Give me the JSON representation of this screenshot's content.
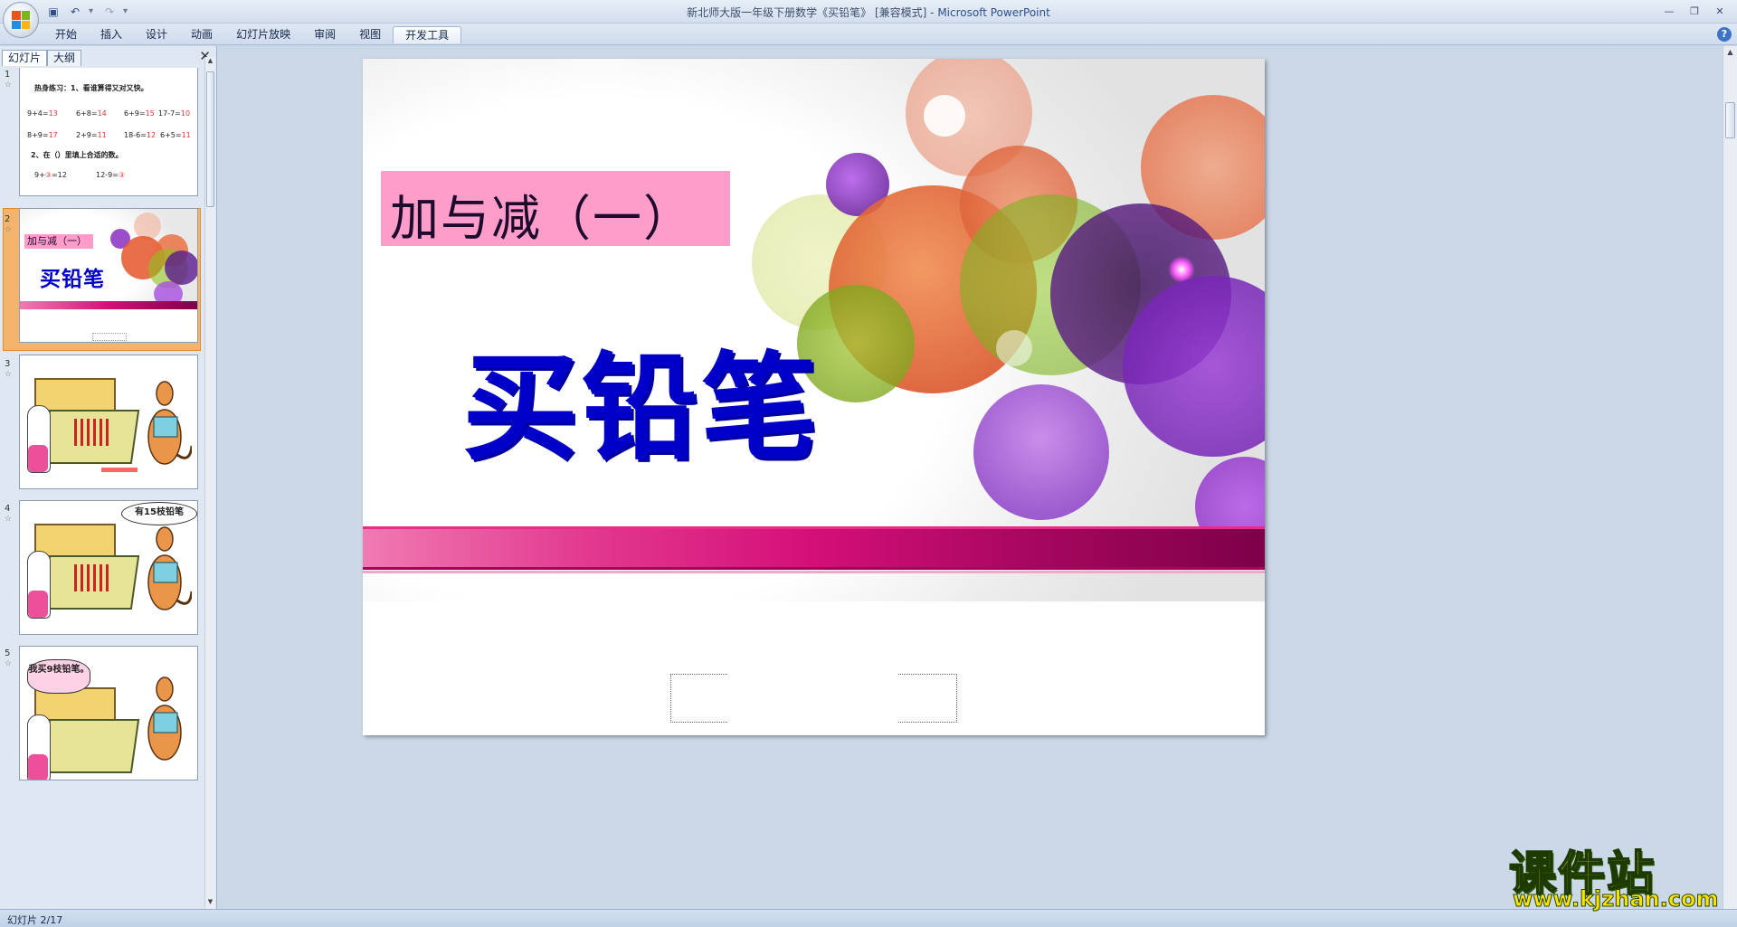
{
  "window": {
    "title": "新北师大版一年级下册数学《买铅笔》 [兼容模式] - ",
    "app_name": "Microsoft PowerPoint"
  },
  "ribbon": {
    "tabs": [
      {
        "label": "开始"
      },
      {
        "label": "插入"
      },
      {
        "label": "设计"
      },
      {
        "label": "动画"
      },
      {
        "label": "幻灯片放映"
      },
      {
        "label": "审阅"
      },
      {
        "label": "视图"
      },
      {
        "label": "开发工具",
        "active": true
      }
    ]
  },
  "pane": {
    "tabs": [
      {
        "label": "幻灯片",
        "active": true
      },
      {
        "label": "大纲"
      }
    ],
    "thumbnails": [
      {
        "number": "1"
      },
      {
        "number": "2",
        "selected": true
      },
      {
        "number": "3"
      },
      {
        "number": "4"
      },
      {
        "number": "5"
      }
    ],
    "slide1": {
      "heading": "热身练习：1、看谁算得又对又快。",
      "row1": [
        {
          "expr": "9+4=",
          "ans": "13"
        },
        {
          "expr": "6+8=",
          "ans": "14"
        },
        {
          "expr": "6+9=",
          "ans": "15"
        },
        {
          "expr": "17-7=",
          "ans": "10"
        }
      ],
      "row2": [
        {
          "expr": "8+9=",
          "ans": "17"
        },
        {
          "expr": "2+9=",
          "ans": "11"
        },
        {
          "expr": "18-6=",
          "ans": "12"
        },
        {
          "expr": "6+5=",
          "ans": "11"
        }
      ],
      "heading2": "2、在（）里填上合适的数。",
      "row3": [
        {
          "expr": "9+",
          "ans": "③",
          "tail": "=12"
        },
        {
          "expr": "12-9=",
          "ans": "③",
          "tail": ""
        }
      ]
    },
    "slide4_bubble": "有15枝铅笔",
    "slide5_bubble": "我买9枝铅笔。"
  },
  "slide": {
    "title": "加与减（一）",
    "subtitle": "买铅笔"
  },
  "status": {
    "slide_indicator": "幻灯片 2/17"
  },
  "watermark": {
    "main": "课件站",
    "url": "www.kjzhan.com"
  },
  "colors": {
    "title_box": "#ff9dca",
    "subtitle": "#0000c8",
    "stripe": "#d40f78"
  }
}
